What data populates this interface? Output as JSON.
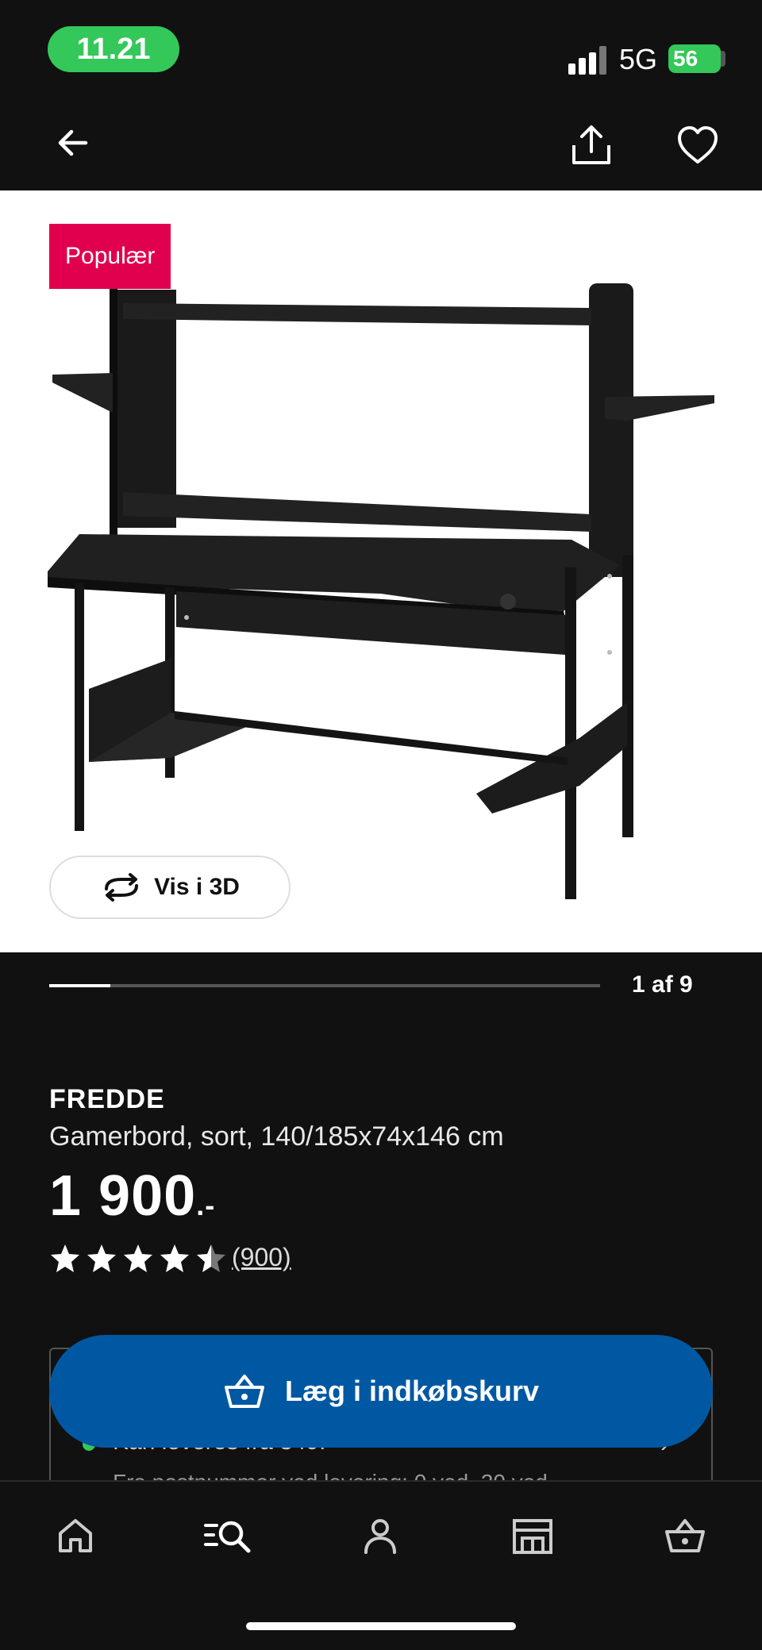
{
  "status_bar": {
    "time": "11.21",
    "network": "5G",
    "battery": "56"
  },
  "top_bar": {
    "icons": [
      "back-arrow-icon",
      "share-icon",
      "heart-icon"
    ]
  },
  "product_image": {
    "badge": "Populær",
    "view_3d_label": "Vis i 3D"
  },
  "gallery": {
    "counter": "1 af 9",
    "progress": 0.111
  },
  "product": {
    "name": "FREDDE",
    "description": "Gamerbord, sort, 140/185x74x146 cm",
    "price": "1 900",
    "price_suffix": ".-",
    "rating": 4.5,
    "reviews": "(900)"
  },
  "delivery": {
    "line1": "Kan leveres fra 349.-",
    "line2": "Fra postnummer ved levering: 0 ved, 20 ved..."
  },
  "cta": {
    "label": "Læg i indkøbskurv"
  },
  "bottom_nav": {
    "items": [
      "home-icon",
      "search-icon",
      "profile-icon",
      "store-icon",
      "cart-icon"
    ]
  },
  "colors": {
    "accent": "#0058a3",
    "badge": "#e0004d",
    "green": "#34c759",
    "background": "#111111"
  }
}
